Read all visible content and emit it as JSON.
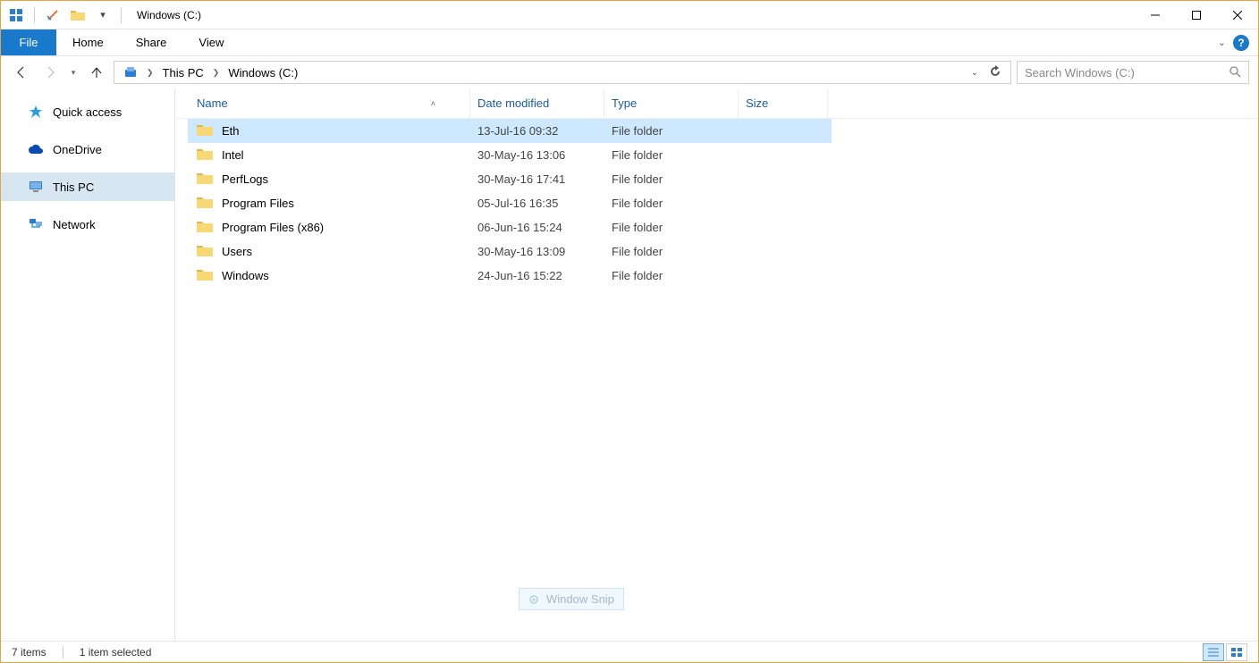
{
  "window": {
    "title": "Windows (C:)"
  },
  "ribbon": {
    "file": "File",
    "tabs": [
      "Home",
      "Share",
      "View"
    ]
  },
  "breadcrumb": {
    "segments": [
      "This PC",
      "Windows (C:)"
    ]
  },
  "search": {
    "placeholder": "Search Windows (C:)"
  },
  "sidebar": {
    "items": [
      {
        "label": "Quick access",
        "icon": "star"
      },
      {
        "label": "OneDrive",
        "icon": "cloud"
      },
      {
        "label": "This PC",
        "icon": "monitor",
        "selected": true
      },
      {
        "label": "Network",
        "icon": "network"
      }
    ]
  },
  "columns": {
    "name": "Name",
    "date": "Date modified",
    "type": "Type",
    "size": "Size"
  },
  "files": [
    {
      "name": "Eth",
      "date": "13-Jul-16 09:32",
      "type": "File folder",
      "size": "",
      "selected": true
    },
    {
      "name": "Intel",
      "date": "30-May-16 13:06",
      "type": "File folder",
      "size": ""
    },
    {
      "name": "PerfLogs",
      "date": "30-May-16 17:41",
      "type": "File folder",
      "size": ""
    },
    {
      "name": "Program Files",
      "date": "05-Jul-16 16:35",
      "type": "File folder",
      "size": ""
    },
    {
      "name": "Program Files (x86)",
      "date": "06-Jun-16 15:24",
      "type": "File folder",
      "size": ""
    },
    {
      "name": "Users",
      "date": "30-May-16 13:09",
      "type": "File folder",
      "size": ""
    },
    {
      "name": "Windows",
      "date": "24-Jun-16 15:22",
      "type": "File folder",
      "size": ""
    }
  ],
  "status": {
    "count": "7 items",
    "selection": "1 item selected"
  },
  "snip": {
    "label": "Window Snip"
  }
}
